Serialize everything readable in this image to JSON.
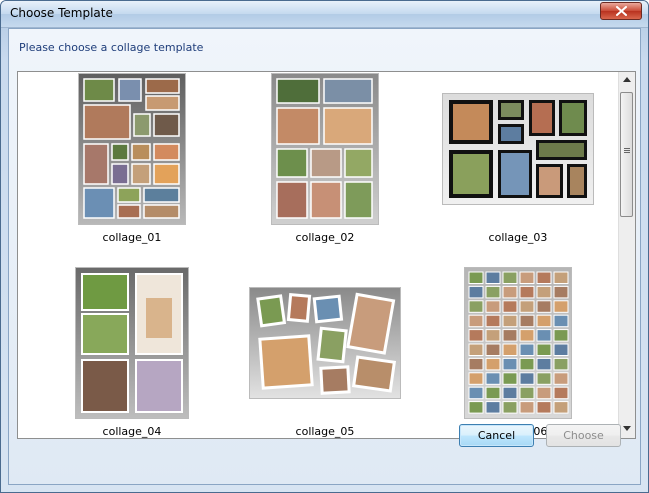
{
  "window": {
    "title": "Choose Template",
    "prompt": "Please choose a collage template"
  },
  "templates": [
    {
      "label": "collage_01"
    },
    {
      "label": "collage_02"
    },
    {
      "label": "collage_03"
    },
    {
      "label": "collage_04"
    },
    {
      "label": "collage_05"
    },
    {
      "label": "collage_06"
    }
  ],
  "buttons": {
    "cancel": "Cancel",
    "choose": "Choose"
  },
  "colors": {
    "title_bar": "#c4d9ef",
    "close_button": "#c94a36",
    "prompt_text": "#1f3d7a",
    "cancel_focus": "#3c7fb1"
  },
  "icons": {
    "close": "close-icon",
    "scroll_up": "chevron-up-icon",
    "scroll_down": "chevron-down-icon"
  }
}
